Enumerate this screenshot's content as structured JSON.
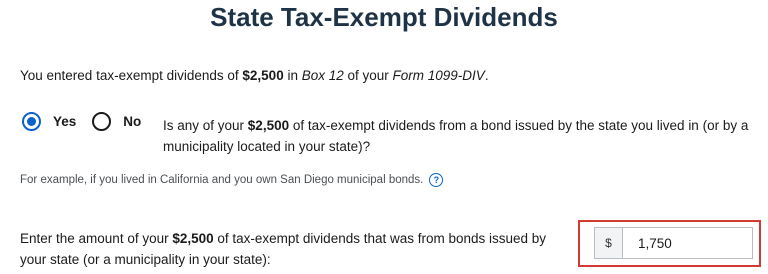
{
  "page": {
    "title": "State Tax-Exempt Dividends"
  },
  "intro": {
    "prefix": "You entered tax-exempt dividends of ",
    "amount": "$2,500",
    "in": " in ",
    "box": "Box 12",
    "of_your": " of your ",
    "form": "Form 1099-DIV",
    "end": "."
  },
  "question": {
    "options": [
      {
        "label": "Yes",
        "selected": true
      },
      {
        "label": "No",
        "selected": false
      }
    ],
    "prefix": "Is any of your ",
    "amount": "$2,500",
    "suffix": " of tax-exempt dividends from a bond issued by the state you lived in (or by a municipality located in your state)?"
  },
  "example": {
    "text": "For example, if you lived in California and you own San Diego municipal bonds.",
    "help_glyph": "?",
    "help_icon": "question-circle-icon"
  },
  "amount_field": {
    "label_prefix": "Enter the amount of your ",
    "label_amount": "$2,500",
    "label_suffix": " of tax-exempt dividends that was from bonds issued by your state (or a municipality in your state):",
    "currency": "$",
    "value": "1,750"
  },
  "colors": {
    "title": "#1f3347",
    "accent": "#0b63c9",
    "highlight_border": "#d43a32"
  }
}
